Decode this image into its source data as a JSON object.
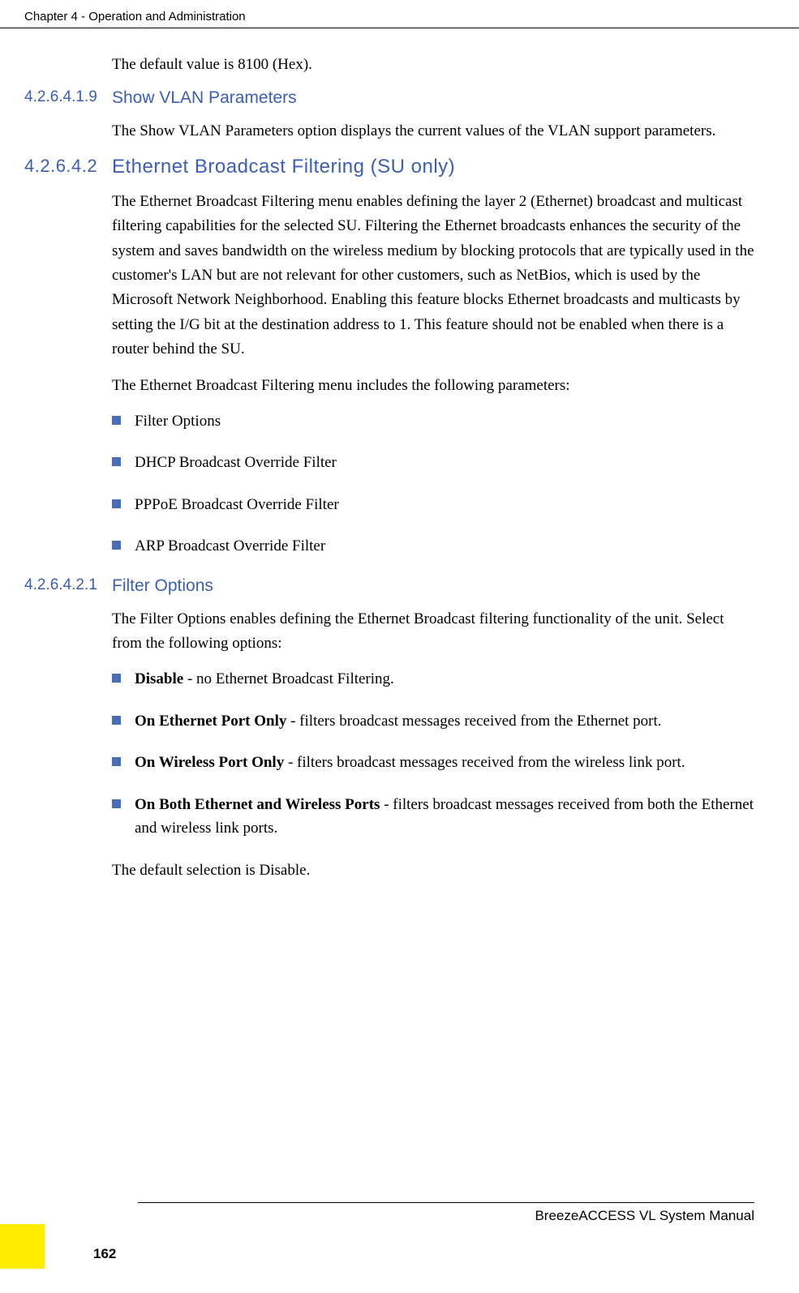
{
  "header": {
    "chapter": "Chapter 4 - Operation and Administration"
  },
  "intro": {
    "default_value": "The default value is 8100 (Hex)."
  },
  "section1": {
    "number": "4.2.6.4.1.9",
    "title": "Show VLAN Parameters",
    "text": "The Show VLAN Parameters option displays the current values of the VLAN support parameters."
  },
  "section2": {
    "number": "4.2.6.4.2",
    "title": "Ethernet Broadcast Filtering (SU only)",
    "para1": "The Ethernet Broadcast Filtering menu enables defining the layer 2 (Ethernet) broadcast and multicast filtering capabilities for the selected SU. Filtering the Ethernet broadcasts enhances the security of the system and saves bandwidth on the wireless medium by blocking protocols that are typically used in the customer's LAN but are not relevant for other customers, such as NetBios, which is used by the Microsoft Network Neighborhood. Enabling this feature blocks Ethernet broadcasts and multicasts by setting the I/G bit at the destination address to 1. This feature should not be enabled when there is a router behind the SU.",
    "para2": "The Ethernet Broadcast Filtering menu includes the following parameters:",
    "bullets": [
      "Filter Options",
      "DHCP Broadcast Override Filter",
      "PPPoE Broadcast Override Filter",
      "ARP Broadcast Override Filter"
    ]
  },
  "section3": {
    "number": "4.2.6.4.2.1",
    "title": "Filter Options",
    "intro": "The Filter Options enables defining the Ethernet Broadcast filtering functionality of the unit. Select from the following options:",
    "options": [
      {
        "bold": "Disable",
        "rest": " - no Ethernet Broadcast Filtering."
      },
      {
        "bold": "On Ethernet Port Only",
        "rest": " - filters broadcast messages received from the Ethernet port."
      },
      {
        "bold": "On Wireless Port Only",
        "rest": " - filters broadcast messages received from the wireless link port."
      },
      {
        "bold": "On Both Ethernet and Wireless Ports",
        "rest": " - filters broadcast messages received from both the Ethernet and wireless link ports."
      }
    ],
    "default": "The default selection is Disable."
  },
  "footer": {
    "manual": "BreezeACCESS VL System Manual",
    "page": "162"
  }
}
